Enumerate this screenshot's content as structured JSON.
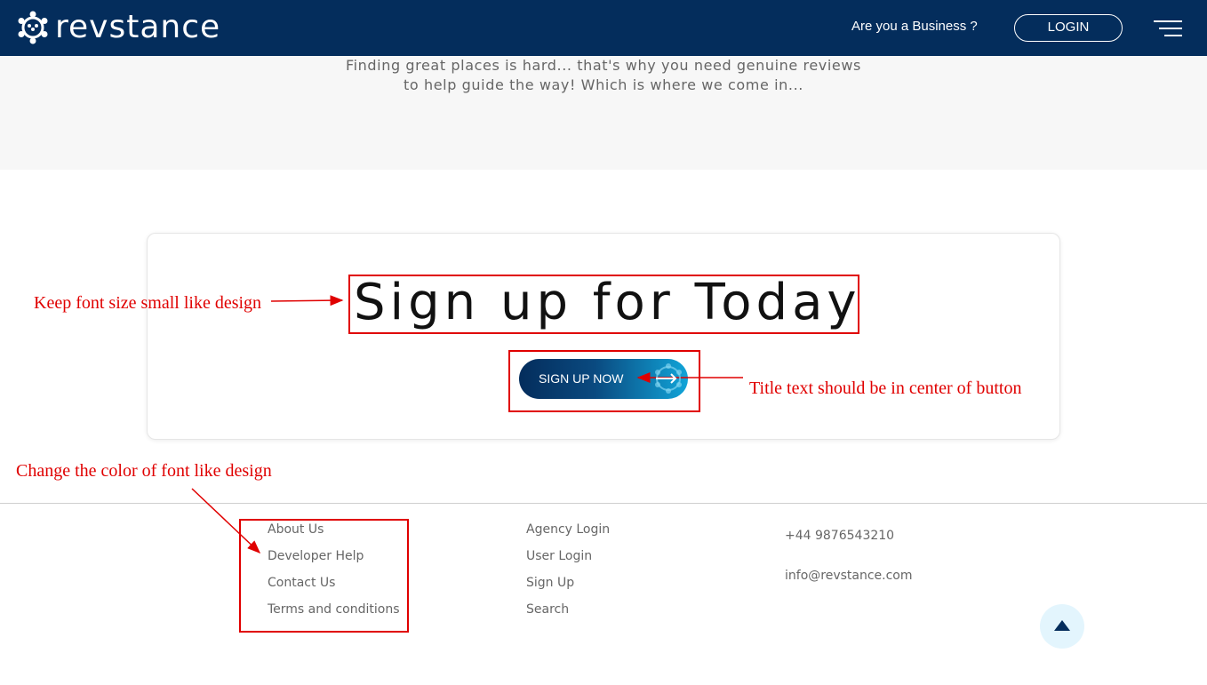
{
  "header": {
    "brand": "revstance",
    "business_link": "Are you a Business ?",
    "login_label": "LOGIN",
    "icons": {
      "logo": "revstance-logo-icon",
      "menu": "hamburger-menu-icon"
    },
    "colors": {
      "background": "#042d5c",
      "text": "#ffffff"
    }
  },
  "hero": {
    "line1": "Finding great places is hard... that's why you need genuine reviews",
    "line2": "to help guide the way! Which is where we come in..."
  },
  "signup": {
    "title": "Sign up for Today",
    "button_label": "SIGN UP NOW",
    "button_icon": "arrow-right-icon"
  },
  "footer": {
    "col1": [
      "About Us",
      "Developer Help",
      "Contact Us",
      "Terms and conditions"
    ],
    "col2": [
      "Agency Login",
      "User Login",
      "Sign Up",
      "Search"
    ],
    "phone": "+44 9876543210",
    "email": "info@revstance.com",
    "scroll_top_icon": "triangle-up-icon"
  },
  "annotations": {
    "font_size": "Keep font size small like design",
    "button_center": "Title text should be in center of button",
    "font_color": "Change the color of font like design",
    "color": "#e00000"
  }
}
